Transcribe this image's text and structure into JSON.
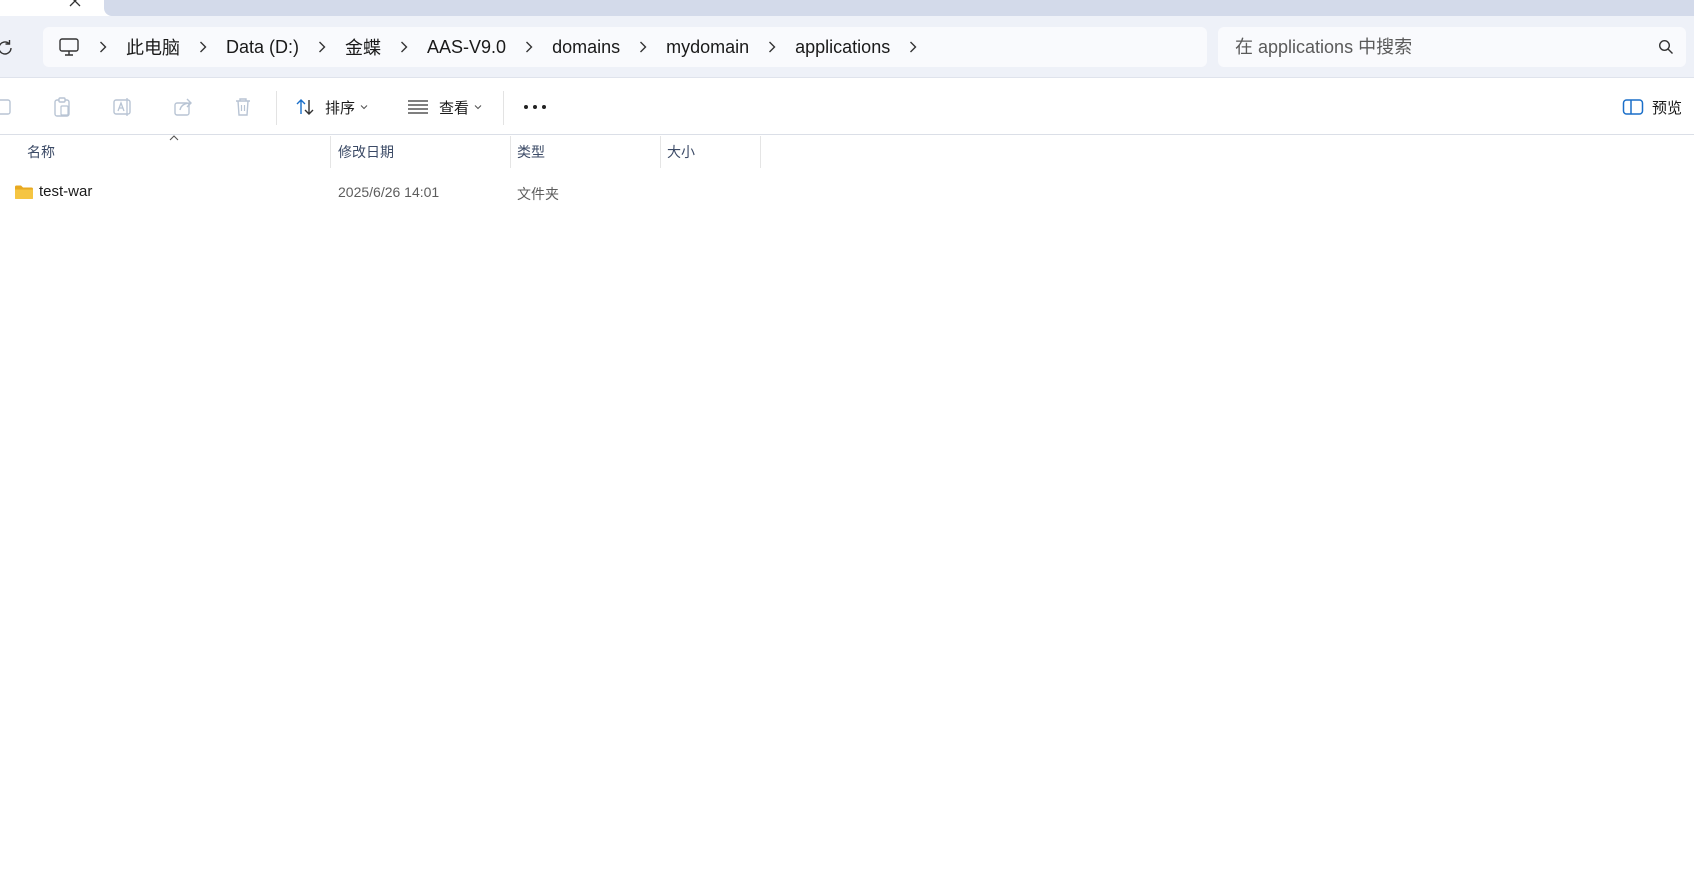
{
  "breadcrumb": {
    "items": [
      "此电脑",
      "Data (D:)",
      "金蝶",
      "AAS-V9.0",
      "domains",
      "mydomain",
      "applications"
    ]
  },
  "search": {
    "placeholder": "在 applications 中搜索"
  },
  "toolbar": {
    "sort_label": "排序",
    "view_label": "查看",
    "preview_label": "预览"
  },
  "columns": {
    "name": "名称",
    "modified": "修改日期",
    "type": "类型",
    "size": "大小"
  },
  "files": [
    {
      "name": "test-war",
      "modified": "2025/6/26 14:01",
      "type": "文件夹",
      "size": ""
    }
  ],
  "colors": {
    "address_bar_bg": "#eef1f8",
    "tab_inactive": "#d3daea",
    "folder_yellow": "#f5c542",
    "accent_blue": "#1a6fc9"
  }
}
